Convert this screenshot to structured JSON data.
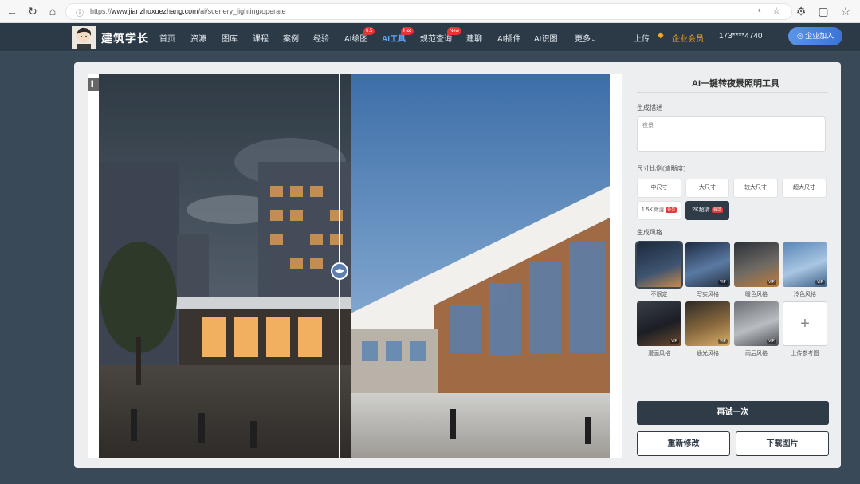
{
  "browser": {
    "url_prefix": "https://",
    "url_host": "www.jianzhuxuezhang.com",
    "url_path": "/ai/scenery_lighting/operate"
  },
  "nav": {
    "logo": "建筑学长",
    "items": [
      {
        "label": "首页"
      },
      {
        "label": "资源"
      },
      {
        "label": "图库"
      },
      {
        "label": "课程"
      },
      {
        "label": "案例"
      },
      {
        "label": "经验"
      },
      {
        "label": "AI绘图",
        "badge": "6.5"
      },
      {
        "label": "AI工具",
        "badge": "Hot",
        "active": true
      },
      {
        "label": "规范查询",
        "badge": "New"
      },
      {
        "label": "建聊"
      },
      {
        "label": "AI插件"
      },
      {
        "label": "AI识图"
      },
      {
        "label": "更多⌄"
      }
    ],
    "upload": "上传",
    "vip": "企业会员",
    "phone": "173****4740",
    "join": "企业加入"
  },
  "panel": {
    "title": "AI一键转夜景照明工具",
    "desc_label": "生成描述",
    "desc_value": "夜景",
    "size_label": "尺寸比例(清晰度)",
    "sizes": [
      {
        "label": "中尺寸"
      },
      {
        "label": "大尺寸"
      },
      {
        "label": "较大尺寸"
      },
      {
        "label": "超大尺寸"
      },
      {
        "label": "1.5K高清",
        "badge": "会员"
      },
      {
        "label": "2K超清",
        "badge": "会员",
        "selected": true
      }
    ],
    "style_label": "生成风格",
    "styles": [
      {
        "label": "不限定",
        "selected": true
      },
      {
        "label": "写实风格",
        "vip": "VIP"
      },
      {
        "label": "暖色风格",
        "vip": "VIP"
      },
      {
        "label": "冷色风格",
        "vip": "VIP"
      },
      {
        "label": "漫画风格",
        "vip": "VIP"
      },
      {
        "label": "通光风格",
        "vip": "VIP"
      },
      {
        "label": "雨后风格",
        "vip": "VIP"
      }
    ],
    "upload_ref": "上传参考图",
    "retry": "再试一次",
    "modify": "重新修改",
    "download": "下载图片"
  },
  "colors": {
    "accent_dark": "#2f3c48",
    "nav_bg": "#2c3a47",
    "active_nav": "#5aa7ff",
    "badge_red": "#e53434",
    "vip_gold": "#f5a623"
  }
}
